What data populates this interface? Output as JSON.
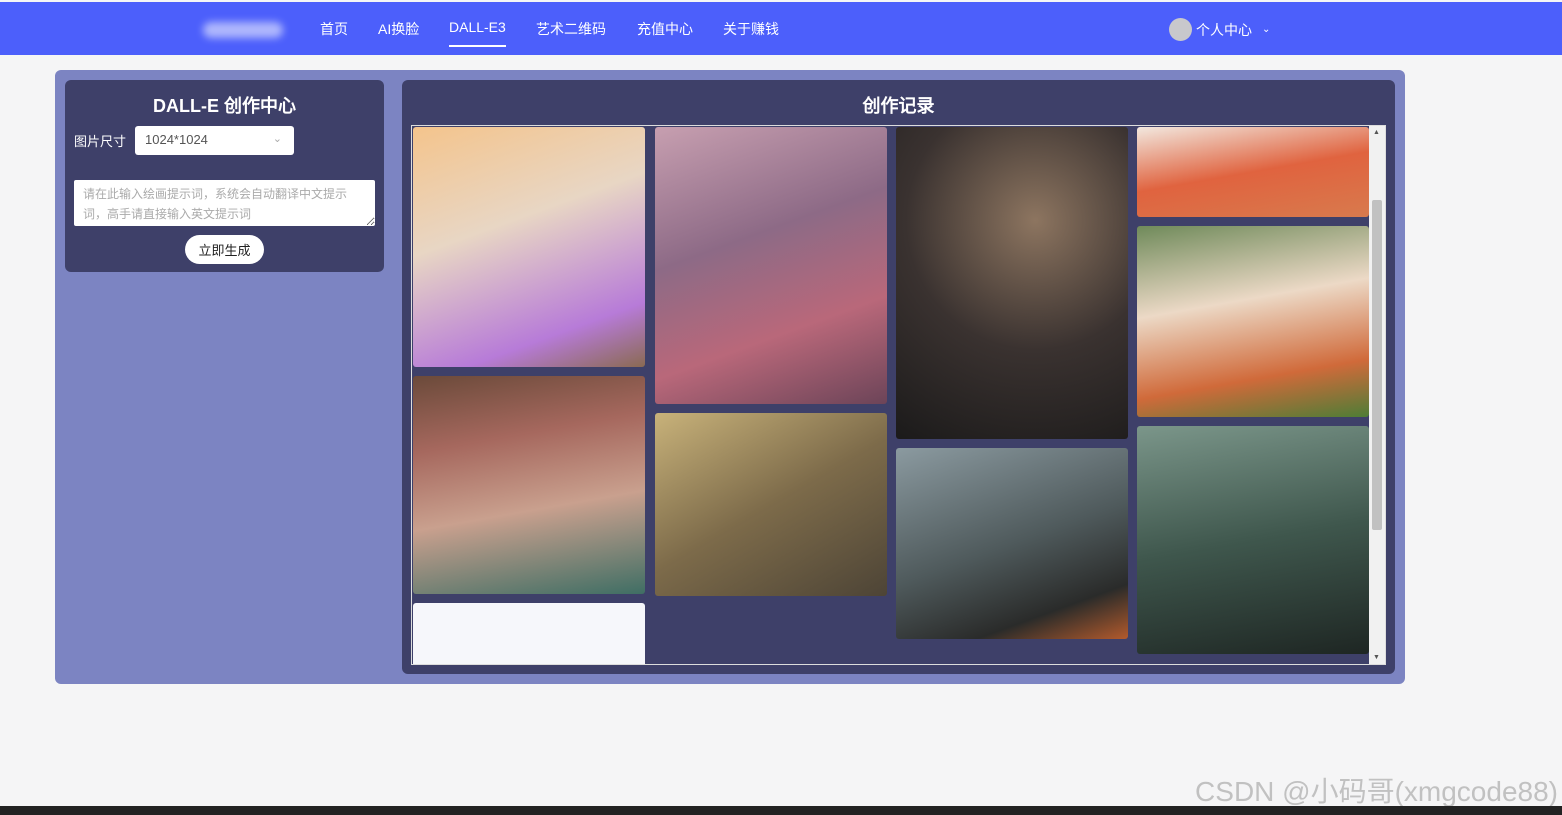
{
  "nav": {
    "items": [
      {
        "label": "首页"
      },
      {
        "label": "AI换脸"
      },
      {
        "label": "DALL-E3",
        "active": true
      },
      {
        "label": "艺术二维码"
      },
      {
        "label": "充值中心"
      },
      {
        "label": "关于赚钱"
      }
    ],
    "user_label": "个人中心"
  },
  "left": {
    "title": "DALL-E 创作中心",
    "size_label": "图片尺寸",
    "size_value": "1024*1024",
    "prompt_placeholder": "请在此输入绘画提示词，系统会自动翻译中文提示词，高手请直接输入英文提示词",
    "generate_label": "立即生成"
  },
  "right": {
    "title": "创作记录"
  },
  "colors": {
    "nav": "#4c5ffb",
    "panel": "#7c84c2",
    "card": "#3e4069"
  },
  "watermark": "CSDN @小码哥(xmgcode88)"
}
